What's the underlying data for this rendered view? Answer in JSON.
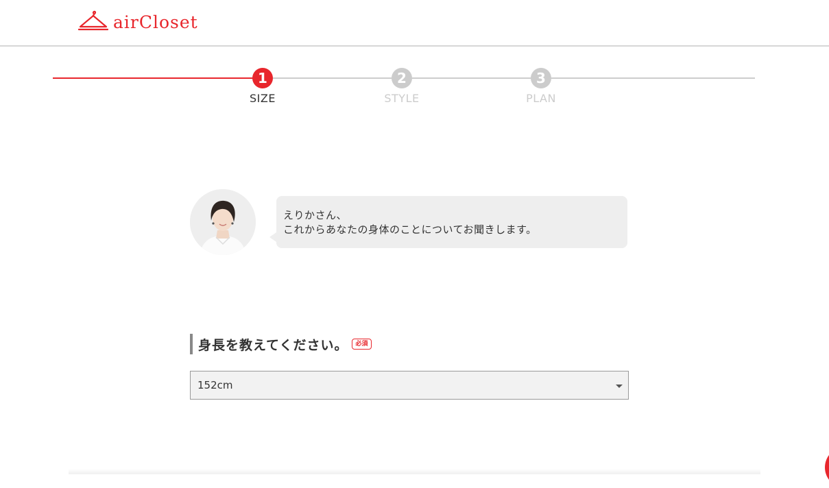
{
  "header": {
    "logo_text": "airCloset",
    "logo_icon": "hanger-icon",
    "brand_color": "#e8262c"
  },
  "stepper": {
    "steps": [
      {
        "number": "1",
        "label": "SIZE",
        "state": "active"
      },
      {
        "number": "2",
        "label": "STYLE",
        "state": "inactive"
      },
      {
        "number": "3",
        "label": "PLAN",
        "state": "inactive"
      }
    ],
    "active_color": "#e8262c",
    "inactive_color": "#cccccc"
  },
  "chat": {
    "avatar": "stylist-avatar",
    "line1": "えりかさん、",
    "line2": "これからあなたの身体のことについてお聞きします。"
  },
  "question": {
    "title": "身長を教えてください。",
    "required_badge": "必須"
  },
  "height_select": {
    "selected_value": "152cm"
  }
}
